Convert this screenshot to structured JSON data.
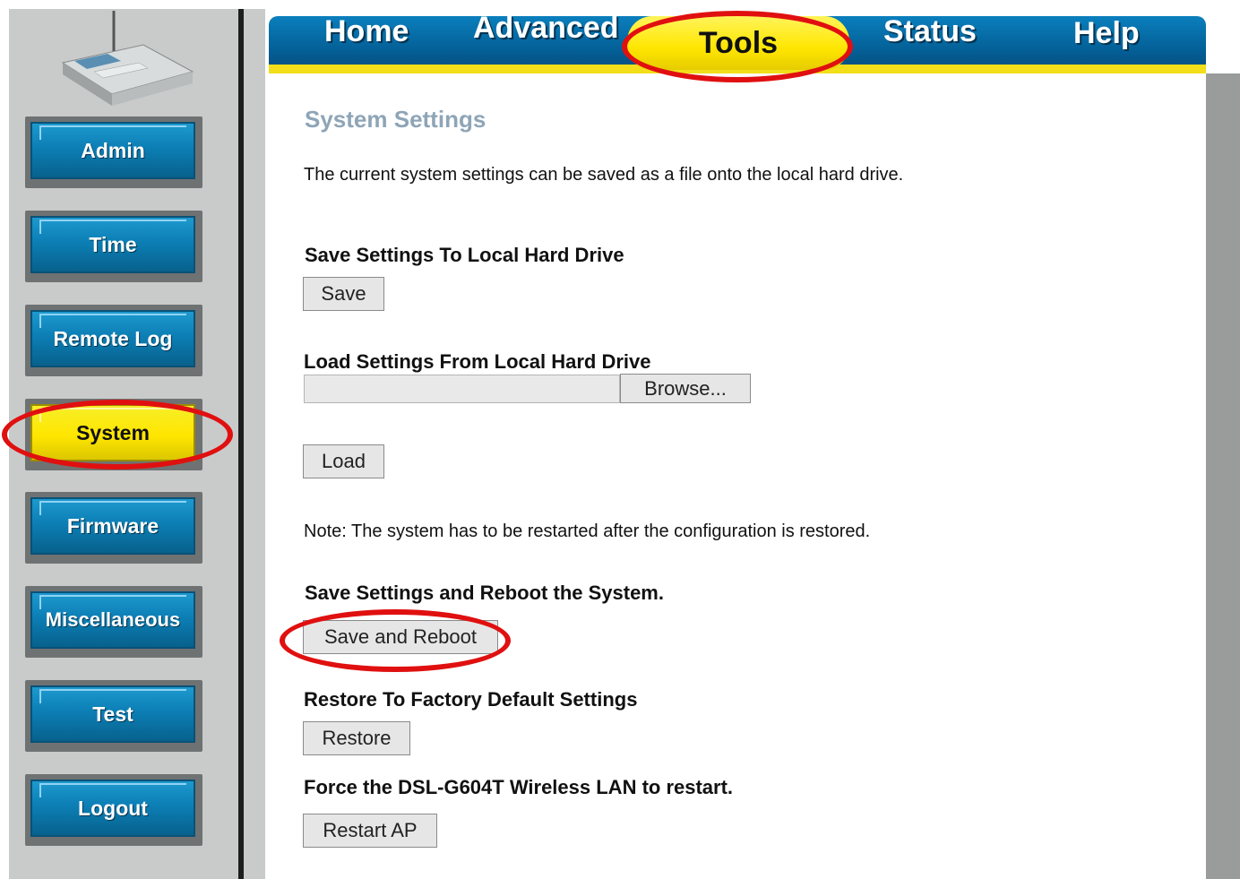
{
  "tabs": {
    "home": "Home",
    "advanced": "Advanced",
    "tools": "Tools",
    "status": "Status",
    "help": "Help"
  },
  "sidebar": {
    "items": [
      {
        "label": "Admin"
      },
      {
        "label": "Time"
      },
      {
        "label": "Remote Log"
      },
      {
        "label": "System"
      },
      {
        "label": "Firmware"
      },
      {
        "label": "Miscellaneous"
      },
      {
        "label": "Test"
      },
      {
        "label": "Logout"
      }
    ],
    "active": "System"
  },
  "main": {
    "title": "System Settings",
    "intro": "The current system settings can be saved as a file onto the local hard drive.",
    "save_section": "Save Settings To Local Hard Drive",
    "save_button": "Save",
    "load_section": "Load Settings From Local Hard Drive",
    "file_value": "",
    "browse_button": "Browse...",
    "load_button": "Load",
    "note": "Note: The system has to be restarted after the configuration is restored.",
    "reboot_section": "Save Settings and Reboot the System.",
    "reboot_button": "Save and Reboot",
    "restore_section": "Restore To Factory Default Settings",
    "restore_button": "Restore",
    "restart_section": "Force the DSL-G604T Wireless LAN to restart.",
    "restart_button": "Restart AP"
  },
  "colors": {
    "highlight_circle": "#e01010",
    "tab_blue": "#0a7fbd",
    "active_yellow": "#ffe600",
    "title_gray": "#8ea5b7"
  },
  "icons": {
    "router": "router-device-icon"
  }
}
